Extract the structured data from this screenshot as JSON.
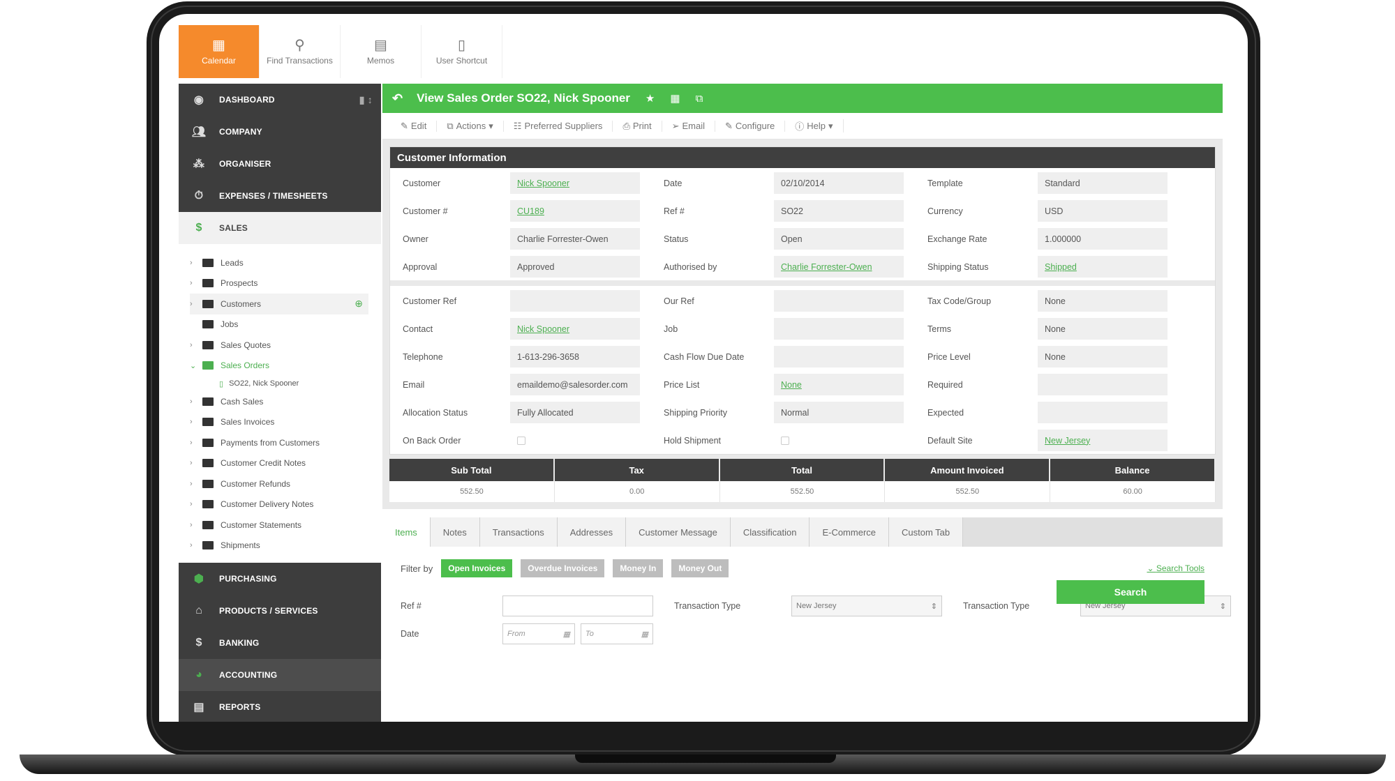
{
  "toolbar": {
    "calendar": "Calendar",
    "find_transactions": "Find Transactions",
    "memos": "Memos",
    "user_shortcut": "User Shortcut"
  },
  "sidebar": {
    "top": [
      {
        "label": "DASHBOARD",
        "icon": "dashboard-icon"
      },
      {
        "label": "COMPANY",
        "icon": "company-icon"
      },
      {
        "label": "ORGANISER",
        "icon": "organiser-icon"
      },
      {
        "label": "EXPENSES / TIMESHEETS",
        "icon": "stopwatch-icon"
      }
    ],
    "sales": "SALES",
    "tree": [
      "Leads",
      "Prospects",
      "Customers",
      "Jobs",
      "Sales Quotes",
      "Sales Orders"
    ],
    "tree_sub": "SO22, Nick Spooner",
    "tree2": [
      "Cash Sales",
      "Sales Invoices",
      "Payments from Customers",
      "Customer Credit Notes",
      "Customer Refunds",
      "Customer Delivery Notes",
      "Customer Statements",
      "Shipments"
    ],
    "bottom": [
      "PURCHASING",
      "PRODUCTS / SERVICES",
      "BANKING",
      "ACCOUNTING",
      "REPORTS"
    ]
  },
  "title": "View Sales Order SO22, Nick Spooner",
  "actions": [
    "Edit",
    "Actions",
    "Preferred Suppliers",
    "Print",
    "Email",
    "Configure",
    "Help"
  ],
  "customer_info": {
    "heading": "Customer Information",
    "rows1": [
      [
        "Customer",
        "Nick Spooner",
        "Date",
        "02/10/2014",
        "Template",
        "Standard"
      ],
      [
        "Customer #",
        "CU189",
        "Ref #",
        "SO22",
        "Currency",
        "USD"
      ],
      [
        "Owner",
        "Charlie Forrester-Owen",
        "Status",
        "Open",
        "Exchange Rate",
        "1.000000"
      ],
      [
        "Approval",
        "Approved",
        "Authorised by",
        "Charlie Forrester-Owen",
        "Shipping Status",
        "Shipped"
      ]
    ],
    "rows2": [
      [
        "Customer Ref",
        "",
        "Our Ref",
        "",
        "Tax Code/Group",
        "None"
      ],
      [
        "Contact",
        "Nick Spooner",
        "Job",
        "",
        "Terms",
        "None"
      ],
      [
        "Telephone",
        "1-613-296-3658",
        "Cash Flow Due Date",
        "",
        "Price Level",
        "None"
      ],
      [
        "Email",
        "emaildemo@salesorder.com",
        "Price List",
        "None",
        "Required",
        ""
      ],
      [
        "Allocation Status",
        "Fully Allocated",
        "Shipping Priority",
        "Normal",
        "Expected",
        ""
      ],
      [
        "On Back Order",
        "",
        "Hold Shipment",
        "",
        "Default Site",
        "New Jersey"
      ]
    ]
  },
  "totals": {
    "headers": [
      "Sub Total",
      "Tax",
      "Total",
      "Amount Invoiced",
      "Balance"
    ],
    "values": [
      "552.50",
      "0.00",
      "552.50",
      "552.50",
      "60.00"
    ]
  },
  "tabs": [
    "Items",
    "Notes",
    "Transactions",
    "Addresses",
    "Customer Message",
    "Classification",
    "E-Commerce",
    "Custom Tab"
  ],
  "filter": {
    "label": "Filter by",
    "chips": [
      "Open Invoices",
      "Overdue Invoices",
      "Money In",
      "Money Out"
    ],
    "search_tools": "Search Tools",
    "ref_label": "Ref #",
    "date_label": "Date",
    "from_ph": "From",
    "to_ph": "To",
    "tt_label1": "Transaction Type",
    "tt_value1": "New Jersey",
    "tt_label2": "Transaction Type",
    "tt_value2": "New Jersey",
    "search_button": "Search"
  },
  "colors": {
    "accent": "#4cbe4c",
    "calendar": "#f58a2c",
    "sidebar": "#3d3d3d"
  }
}
